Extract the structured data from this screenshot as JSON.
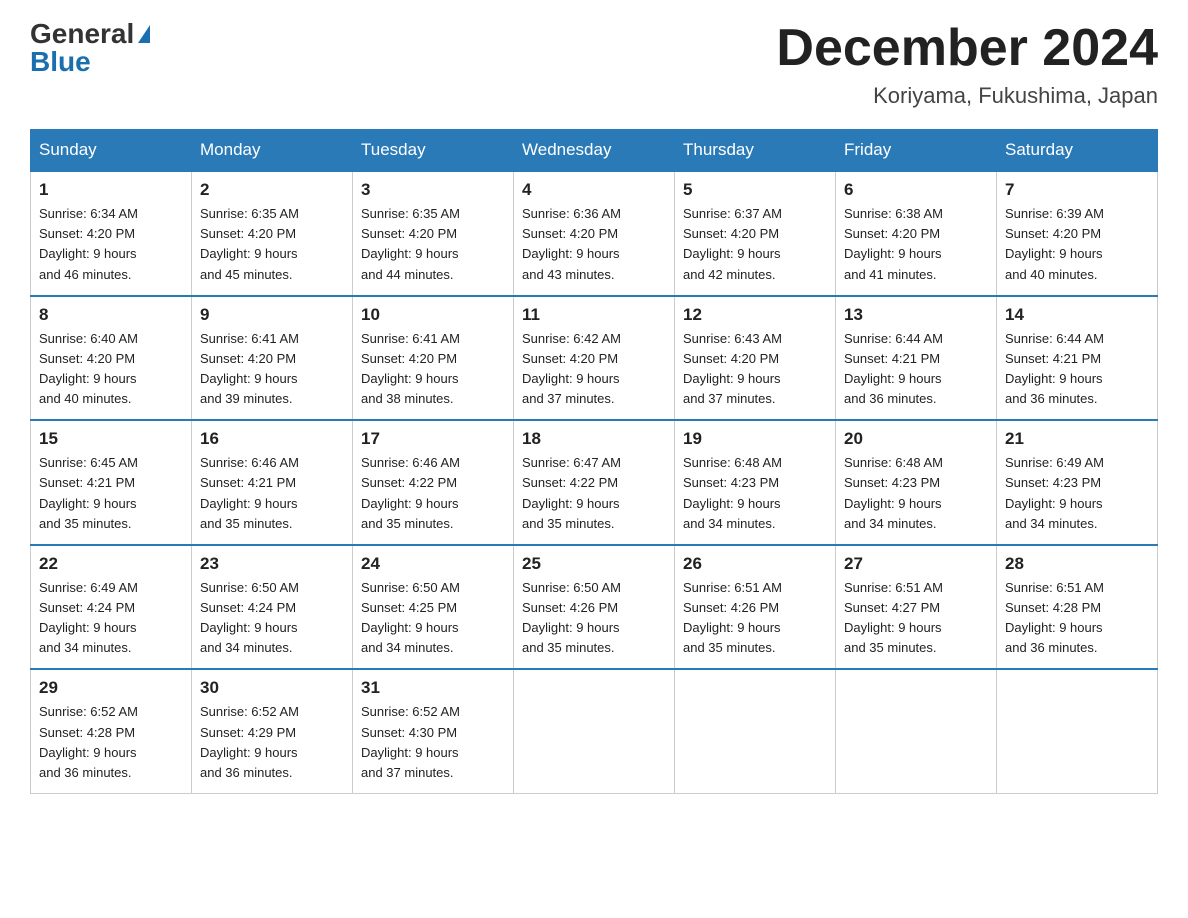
{
  "header": {
    "logo_general": "General",
    "logo_blue": "Blue",
    "month_title": "December 2024",
    "location": "Koriyama, Fukushima, Japan"
  },
  "days_of_week": [
    "Sunday",
    "Monday",
    "Tuesday",
    "Wednesday",
    "Thursday",
    "Friday",
    "Saturday"
  ],
  "weeks": [
    [
      {
        "day": "1",
        "sunrise": "6:34 AM",
        "sunset": "4:20 PM",
        "daylight": "9 hours and 46 minutes."
      },
      {
        "day": "2",
        "sunrise": "6:35 AM",
        "sunset": "4:20 PM",
        "daylight": "9 hours and 45 minutes."
      },
      {
        "day": "3",
        "sunrise": "6:35 AM",
        "sunset": "4:20 PM",
        "daylight": "9 hours and 44 minutes."
      },
      {
        "day": "4",
        "sunrise": "6:36 AM",
        "sunset": "4:20 PM",
        "daylight": "9 hours and 43 minutes."
      },
      {
        "day": "5",
        "sunrise": "6:37 AM",
        "sunset": "4:20 PM",
        "daylight": "9 hours and 42 minutes."
      },
      {
        "day": "6",
        "sunrise": "6:38 AM",
        "sunset": "4:20 PM",
        "daylight": "9 hours and 41 minutes."
      },
      {
        "day": "7",
        "sunrise": "6:39 AM",
        "sunset": "4:20 PM",
        "daylight": "9 hours and 40 minutes."
      }
    ],
    [
      {
        "day": "8",
        "sunrise": "6:40 AM",
        "sunset": "4:20 PM",
        "daylight": "9 hours and 40 minutes."
      },
      {
        "day": "9",
        "sunrise": "6:41 AM",
        "sunset": "4:20 PM",
        "daylight": "9 hours and 39 minutes."
      },
      {
        "day": "10",
        "sunrise": "6:41 AM",
        "sunset": "4:20 PM",
        "daylight": "9 hours and 38 minutes."
      },
      {
        "day": "11",
        "sunrise": "6:42 AM",
        "sunset": "4:20 PM",
        "daylight": "9 hours and 37 minutes."
      },
      {
        "day": "12",
        "sunrise": "6:43 AM",
        "sunset": "4:20 PM",
        "daylight": "9 hours and 37 minutes."
      },
      {
        "day": "13",
        "sunrise": "6:44 AM",
        "sunset": "4:21 PM",
        "daylight": "9 hours and 36 minutes."
      },
      {
        "day": "14",
        "sunrise": "6:44 AM",
        "sunset": "4:21 PM",
        "daylight": "9 hours and 36 minutes."
      }
    ],
    [
      {
        "day": "15",
        "sunrise": "6:45 AM",
        "sunset": "4:21 PM",
        "daylight": "9 hours and 35 minutes."
      },
      {
        "day": "16",
        "sunrise": "6:46 AM",
        "sunset": "4:21 PM",
        "daylight": "9 hours and 35 minutes."
      },
      {
        "day": "17",
        "sunrise": "6:46 AM",
        "sunset": "4:22 PM",
        "daylight": "9 hours and 35 minutes."
      },
      {
        "day": "18",
        "sunrise": "6:47 AM",
        "sunset": "4:22 PM",
        "daylight": "9 hours and 35 minutes."
      },
      {
        "day": "19",
        "sunrise": "6:48 AM",
        "sunset": "4:23 PM",
        "daylight": "9 hours and 34 minutes."
      },
      {
        "day": "20",
        "sunrise": "6:48 AM",
        "sunset": "4:23 PM",
        "daylight": "9 hours and 34 minutes."
      },
      {
        "day": "21",
        "sunrise": "6:49 AM",
        "sunset": "4:23 PM",
        "daylight": "9 hours and 34 minutes."
      }
    ],
    [
      {
        "day": "22",
        "sunrise": "6:49 AM",
        "sunset": "4:24 PM",
        "daylight": "9 hours and 34 minutes."
      },
      {
        "day": "23",
        "sunrise": "6:50 AM",
        "sunset": "4:24 PM",
        "daylight": "9 hours and 34 minutes."
      },
      {
        "day": "24",
        "sunrise": "6:50 AM",
        "sunset": "4:25 PM",
        "daylight": "9 hours and 34 minutes."
      },
      {
        "day": "25",
        "sunrise": "6:50 AM",
        "sunset": "4:26 PM",
        "daylight": "9 hours and 35 minutes."
      },
      {
        "day": "26",
        "sunrise": "6:51 AM",
        "sunset": "4:26 PM",
        "daylight": "9 hours and 35 minutes."
      },
      {
        "day": "27",
        "sunrise": "6:51 AM",
        "sunset": "4:27 PM",
        "daylight": "9 hours and 35 minutes."
      },
      {
        "day": "28",
        "sunrise": "6:51 AM",
        "sunset": "4:28 PM",
        "daylight": "9 hours and 36 minutes."
      }
    ],
    [
      {
        "day": "29",
        "sunrise": "6:52 AM",
        "sunset": "4:28 PM",
        "daylight": "9 hours and 36 minutes."
      },
      {
        "day": "30",
        "sunrise": "6:52 AM",
        "sunset": "4:29 PM",
        "daylight": "9 hours and 36 minutes."
      },
      {
        "day": "31",
        "sunrise": "6:52 AM",
        "sunset": "4:30 PM",
        "daylight": "9 hours and 37 minutes."
      },
      null,
      null,
      null,
      null
    ]
  ]
}
